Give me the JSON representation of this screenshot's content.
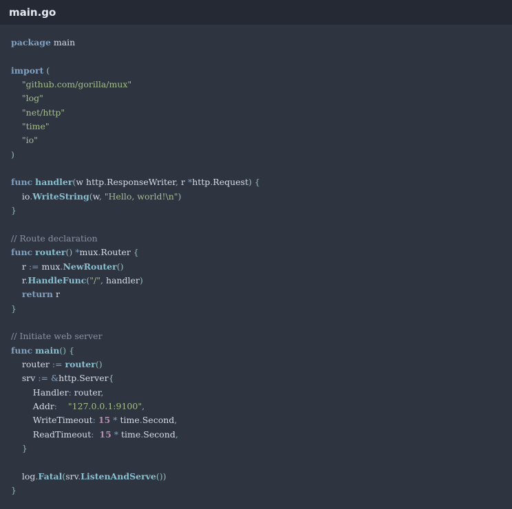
{
  "file": {
    "name": "main.go"
  },
  "lines": [
    [
      {
        "t": "package",
        "c": "kw"
      },
      {
        "t": " main",
        "c": "tx"
      }
    ],
    [],
    [
      {
        "t": "import",
        "c": "kw"
      },
      {
        "t": " (",
        "c": "pn"
      }
    ],
    [
      {
        "t": "    ",
        "c": "tx"
      },
      {
        "t": "\"github.com/gorilla/mux\"",
        "c": "str"
      }
    ],
    [
      {
        "t": "    ",
        "c": "tx"
      },
      {
        "t": "\"log\"",
        "c": "str"
      }
    ],
    [
      {
        "t": "    ",
        "c": "tx"
      },
      {
        "t": "\"net/http\"",
        "c": "str"
      }
    ],
    [
      {
        "t": "    ",
        "c": "tx"
      },
      {
        "t": "\"time\"",
        "c": "str"
      }
    ],
    [
      {
        "t": "    ",
        "c": "tx"
      },
      {
        "t": "\"io\"",
        "c": "str"
      }
    ],
    [
      {
        "t": ")",
        "c": "pn"
      }
    ],
    [],
    [
      {
        "t": "func",
        "c": "kw"
      },
      {
        "t": " ",
        "c": "tx"
      },
      {
        "t": "handler",
        "c": "fn"
      },
      {
        "t": "(",
        "c": "pn"
      },
      {
        "t": "w http",
        "c": "tx"
      },
      {
        "t": ".",
        "c": "pn"
      },
      {
        "t": "ResponseWriter",
        "c": "tx"
      },
      {
        "t": ",",
        "c": "pn"
      },
      {
        "t": " r ",
        "c": "tx"
      },
      {
        "t": "*",
        "c": "op"
      },
      {
        "t": "http",
        "c": "tx"
      },
      {
        "t": ".",
        "c": "pn"
      },
      {
        "t": "Request",
        "c": "tx"
      },
      {
        "t": ")",
        "c": "pn"
      },
      {
        "t": " {",
        "c": "pn"
      }
    ],
    [
      {
        "t": "    io",
        "c": "tx"
      },
      {
        "t": ".",
        "c": "pn"
      },
      {
        "t": "WriteString",
        "c": "fn"
      },
      {
        "t": "(",
        "c": "pn"
      },
      {
        "t": "w",
        "c": "tx"
      },
      {
        "t": ",",
        "c": "pn"
      },
      {
        "t": " ",
        "c": "tx"
      },
      {
        "t": "\"Hello, world!\\n\"",
        "c": "str"
      },
      {
        "t": ")",
        "c": "pn"
      }
    ],
    [
      {
        "t": "}",
        "c": "pn"
      }
    ],
    [],
    [
      {
        "t": "// Route declaration",
        "c": "cm"
      }
    ],
    [
      {
        "t": "func",
        "c": "kw"
      },
      {
        "t": " ",
        "c": "tx"
      },
      {
        "t": "router",
        "c": "fn"
      },
      {
        "t": "()",
        "c": "pn"
      },
      {
        "t": " ",
        "c": "tx"
      },
      {
        "t": "*",
        "c": "op"
      },
      {
        "t": "mux",
        "c": "tx"
      },
      {
        "t": ".",
        "c": "pn"
      },
      {
        "t": "Router",
        "c": "tx"
      },
      {
        "t": " {",
        "c": "pn"
      }
    ],
    [
      {
        "t": "    r ",
        "c": "tx"
      },
      {
        "t": ":=",
        "c": "op"
      },
      {
        "t": " mux",
        "c": "tx"
      },
      {
        "t": ".",
        "c": "pn"
      },
      {
        "t": "NewRouter",
        "c": "fn"
      },
      {
        "t": "()",
        "c": "pn"
      }
    ],
    [
      {
        "t": "    r",
        "c": "tx"
      },
      {
        "t": ".",
        "c": "pn"
      },
      {
        "t": "HandleFunc",
        "c": "fn"
      },
      {
        "t": "(",
        "c": "pn"
      },
      {
        "t": "\"/\"",
        "c": "str"
      },
      {
        "t": ",",
        "c": "pn"
      },
      {
        "t": " handler",
        "c": "tx"
      },
      {
        "t": ")",
        "c": "pn"
      }
    ],
    [
      {
        "t": "    ",
        "c": "tx"
      },
      {
        "t": "return",
        "c": "kw"
      },
      {
        "t": " r",
        "c": "tx"
      }
    ],
    [
      {
        "t": "}",
        "c": "pn"
      }
    ],
    [],
    [
      {
        "t": "// Initiate web server",
        "c": "cm"
      }
    ],
    [
      {
        "t": "func",
        "c": "kw"
      },
      {
        "t": " ",
        "c": "tx"
      },
      {
        "t": "main",
        "c": "fn"
      },
      {
        "t": "()",
        "c": "pn"
      },
      {
        "t": " {",
        "c": "pn"
      }
    ],
    [
      {
        "t": "    router ",
        "c": "tx"
      },
      {
        "t": ":=",
        "c": "op"
      },
      {
        "t": " ",
        "c": "tx"
      },
      {
        "t": "router",
        "c": "fn"
      },
      {
        "t": "()",
        "c": "pn"
      }
    ],
    [
      {
        "t": "    srv ",
        "c": "tx"
      },
      {
        "t": ":=",
        "c": "op"
      },
      {
        "t": " ",
        "c": "tx"
      },
      {
        "t": "&",
        "c": "op"
      },
      {
        "t": "http",
        "c": "tx"
      },
      {
        "t": ".",
        "c": "pn"
      },
      {
        "t": "Server",
        "c": "tx"
      },
      {
        "t": "{",
        "c": "pn"
      }
    ],
    [
      {
        "t": "        Handler",
        "c": "tx"
      },
      {
        "t": ":",
        "c": "op"
      },
      {
        "t": " router",
        "c": "tx"
      },
      {
        "t": ",",
        "c": "pn"
      }
    ],
    [
      {
        "t": "        Addr",
        "c": "tx"
      },
      {
        "t": ":",
        "c": "op"
      },
      {
        "t": "    ",
        "c": "tx"
      },
      {
        "t": "\"127.0.0.1:9100\"",
        "c": "str"
      },
      {
        "t": ",",
        "c": "pn"
      }
    ],
    [
      {
        "t": "        WriteTimeout",
        "c": "tx"
      },
      {
        "t": ":",
        "c": "op"
      },
      {
        "t": " ",
        "c": "tx"
      },
      {
        "t": "15",
        "c": "num"
      },
      {
        "t": " ",
        "c": "tx"
      },
      {
        "t": "*",
        "c": "op"
      },
      {
        "t": " time",
        "c": "tx"
      },
      {
        "t": ".",
        "c": "pn"
      },
      {
        "t": "Second",
        "c": "tx"
      },
      {
        "t": ",",
        "c": "pn"
      }
    ],
    [
      {
        "t": "        ReadTimeout",
        "c": "tx"
      },
      {
        "t": ":",
        "c": "op"
      },
      {
        "t": "  ",
        "c": "tx"
      },
      {
        "t": "15",
        "c": "num"
      },
      {
        "t": " ",
        "c": "tx"
      },
      {
        "t": "*",
        "c": "op"
      },
      {
        "t": " time",
        "c": "tx"
      },
      {
        "t": ".",
        "c": "pn"
      },
      {
        "t": "Second",
        "c": "tx"
      },
      {
        "t": ",",
        "c": "pn"
      }
    ],
    [
      {
        "t": "    }",
        "c": "pn"
      }
    ],
    [],
    [
      {
        "t": "    log",
        "c": "tx"
      },
      {
        "t": ".",
        "c": "pn"
      },
      {
        "t": "Fatal",
        "c": "fn"
      },
      {
        "t": "(",
        "c": "pn"
      },
      {
        "t": "srv",
        "c": "tx"
      },
      {
        "t": ".",
        "c": "pn"
      },
      {
        "t": "ListenAndServe",
        "c": "fn"
      },
      {
        "t": "())",
        "c": "pn"
      }
    ],
    [
      {
        "t": "}",
        "c": "pn"
      }
    ]
  ]
}
